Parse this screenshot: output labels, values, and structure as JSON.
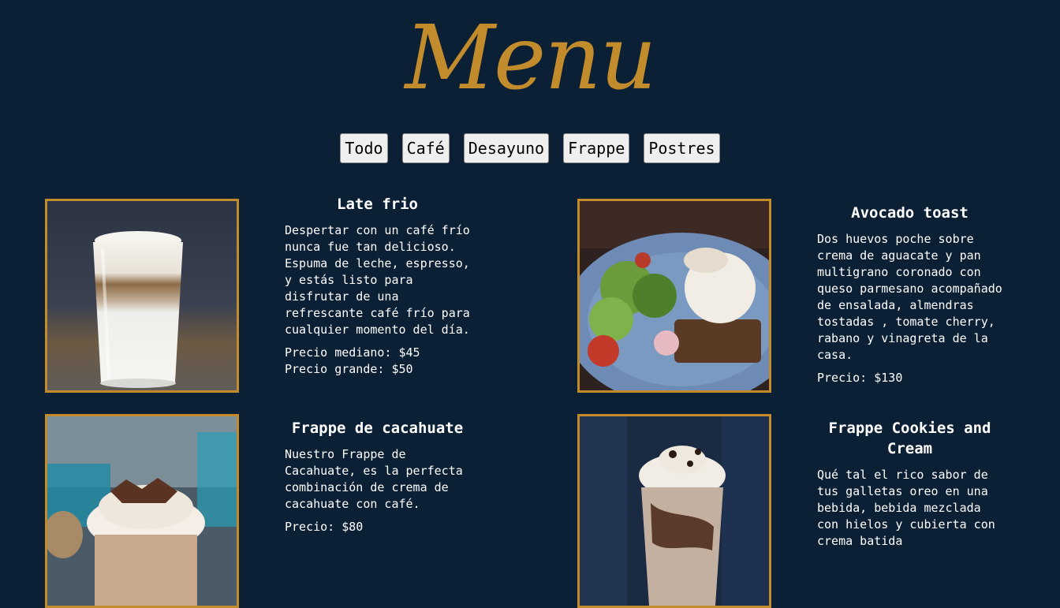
{
  "page": {
    "title": "Menu"
  },
  "filters": [
    {
      "label": "Todo"
    },
    {
      "label": "Café"
    },
    {
      "label": "Desayuno"
    },
    {
      "label": "Frappe"
    },
    {
      "label": "Postres"
    }
  ],
  "items": [
    {
      "name": "Late frio",
      "description": "Despertar con un café frío nunca fue tan delicioso. Espuma de leche, espresso, y estás listo para disfrutar de una refrescante café frío para cualquier momento del día.",
      "price_lines": [
        "Precio mediano: $45",
        "Precio grande: $50"
      ]
    },
    {
      "name": "Avocado toast",
      "description": "Dos huevos poche sobre crema de aguacate y pan multigrano coronado con queso parmesano acompañado de ensalada, almendras tostadas , tomate cherry, rabano y vinagreta de la casa.",
      "price_lines": [
        "Precio: $130"
      ]
    },
    {
      "name": "Frappe de cacahuate",
      "description": "Nuestro Frappe de Cacahuate, es la perfecta combinación de crema de cacahuate con café.",
      "price_lines": [
        "Precio: $80"
      ]
    },
    {
      "name": "Frappe Cookies and Cream",
      "description": "Qué tal el rico sabor de tus galletas oreo en una bebida, bebida mezclada con hielos y cubierta con crema batida",
      "price_lines": []
    }
  ],
  "colors": {
    "background": "#0b2035",
    "accent": "#c28b2c",
    "text": "#ffffff"
  }
}
